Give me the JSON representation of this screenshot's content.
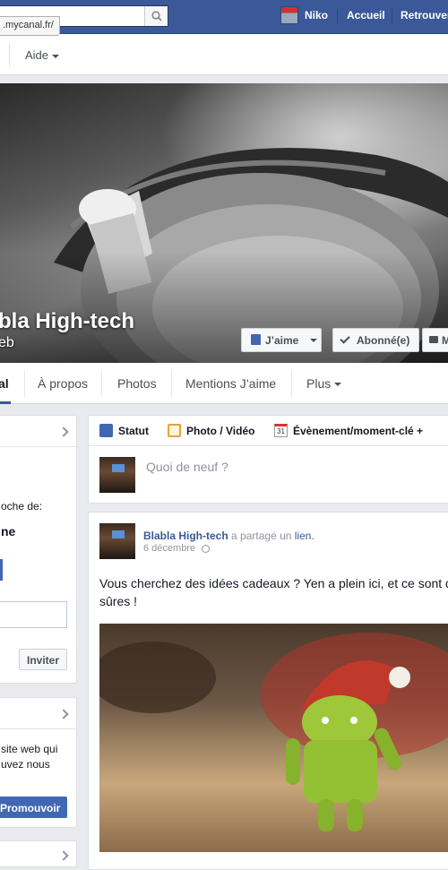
{
  "topbar": {
    "url_hint": ".mycanal.fr/",
    "user_name": "Niko",
    "home": "Accueil",
    "find": "Retrouver"
  },
  "subnav": {
    "help": "Aide"
  },
  "page": {
    "name": "bla High-tech",
    "category": "eb"
  },
  "cover_buttons": {
    "like": "J’aime",
    "subscribed": "Abonné(e)",
    "message": "M"
  },
  "tabs": {
    "active": "al",
    "about": "À propos",
    "photos": "Photos",
    "mentions": "Mentions J’aime",
    "more": "Plus"
  },
  "left": {
    "invite_text": "oche de:",
    "name_partial": "ne",
    "invite": "Invite​r",
    "promo_line1": "site web qui",
    "promo_line2": "uvez nous",
    "promote": "Promouvoir"
  },
  "composer": {
    "status": "Statut",
    "photo": "Photo / Vidéo",
    "event": "Évènement/moment-clé +",
    "calendar_day": "31",
    "placeholder": "Quoi de neuf ?"
  },
  "post": {
    "author": "Blabla High-tech",
    "shared": "a partagé un",
    "link_word": "lien.",
    "date": "6 décembre",
    "text": "Vous cherchez des idées cadeaux ? Yen a plein ici, et ce sont d",
    "text2": "sûres !"
  },
  "colors": {
    "brand": "#3b5998",
    "accent_button": "#4267b2"
  }
}
